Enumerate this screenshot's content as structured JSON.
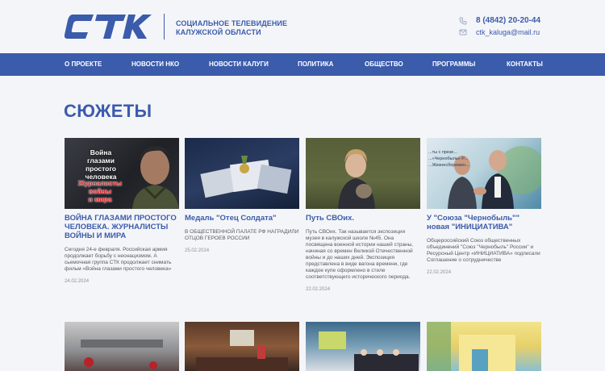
{
  "header": {
    "logo_text": "СТК",
    "org_name_line1": "СОЦИАЛЬНОЕ ТЕЛЕВИДЕНИЕ",
    "org_name_line2": "КАЛУЖСКОЙ ОБЛАСТИ",
    "phone": "8 (4842) 20-20-44",
    "email": "ctk_kaluga@mail.ru",
    "phone_icon": "phone-icon",
    "email_icon": "mail-icon"
  },
  "nav": {
    "items": [
      "О ПРОЕКТЕ",
      "НОВОСТИ НКО",
      "НОВОСТИ КАЛУГИ",
      "ПОЛИТИКА",
      "ОБЩЕСТВО",
      "ПРОГРАММЫ",
      "КОНТАКТЫ"
    ]
  },
  "page_title": "СЮЖЕТЫ",
  "cards": [
    {
      "thumb_caption1": "Война глазами",
      "thumb_caption2": "простого",
      "thumb_caption3": "человека",
      "thumb_caption4": "Журналисты войны",
      "thumb_caption5": "и мира",
      "title": "ВОЙНА ГЛАЗАМИ ПРОСТОГО ЧЕЛОВЕКА. ЖУРНАЛИСТЫ ВОЙНЫ И МИРА",
      "desc": "Сегодня 24-е февраля. Российская армия продолжает борьбу с неонацизмом. А сьемочная группа СТК продолжает снимать фильм «Война глазами простого человека»",
      "date": "24.02.2024"
    },
    {
      "title": "Медаль \"Отец Солдата\"",
      "desc": "В ОБЩЕСТВЕННОЙ ПАЛАТЕ РФ НАГРАДИЛИ ОТЦОВ ГЕРОЕВ РОССИИ",
      "date": "25.02.2024"
    },
    {
      "title": "Путь СВОих.",
      "desc": "Путь СВОих. Так называется экспозиция музея в калужской школе №45. Она посвящена военной истории нашей страны, начиная со времен Великой Отечественной войны и до наших дней. Экспозиция представлена в виде вагона времени, где каждое купе оформлено в стиле соответствующего исторического периода.",
      "date": "22.02.2024"
    },
    {
      "thumb_caption1": "...ты с презе...",
      "thumb_caption2": "...«Чернобыль» Р...",
      "thumb_caption3": "...Жизнесбережен...",
      "title": "У \"Союза \"Чернобыль\"\" новая \"ИНИЦИАТИВА\"",
      "desc": "Общероссийский Союз общественных объединений \"Союз \"Чернобыль\" России\" и Ресурсный Центр «ИНИЦИАТИВА» подписали Соглашение о сотрудничестве",
      "date": "22.02.2024"
    }
  ],
  "colors": {
    "brand": "#3b5bab",
    "background": "#f4f5f8",
    "body_text": "#555a63",
    "date_text": "#8a8f98"
  }
}
